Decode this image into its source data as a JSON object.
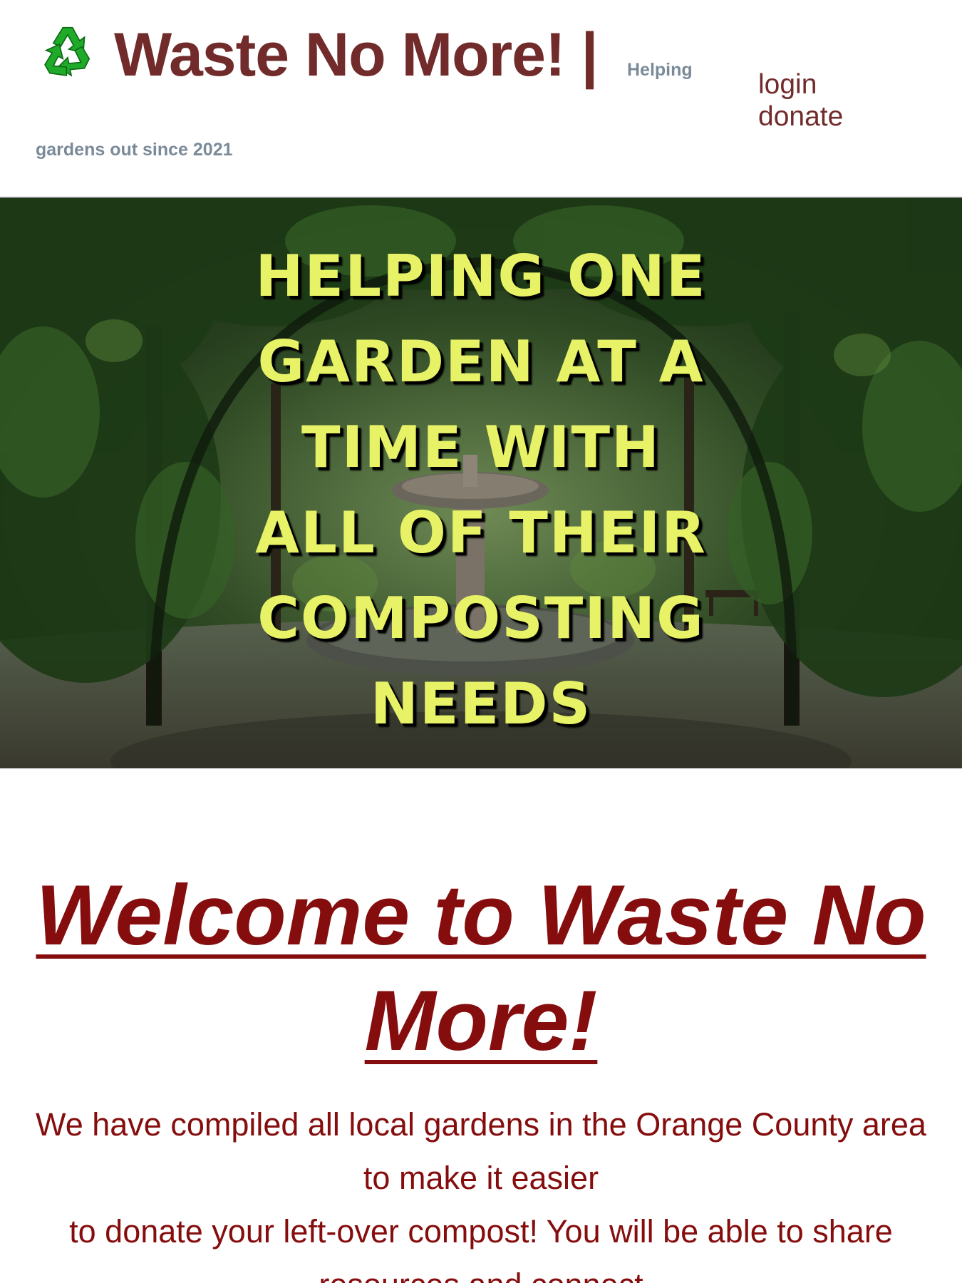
{
  "header": {
    "logo_icon": "recycle-icon",
    "title": "Waste No More! |",
    "tagline_part1": "Helping",
    "tagline_part2": "gardens out since 2021",
    "nav": {
      "login": "login",
      "donate": "donate"
    },
    "colors": {
      "title": "#722b2b",
      "tagline": "#7b8a99",
      "nav": "#722b2b"
    }
  },
  "hero": {
    "lines": [
      "HELPING ONE",
      "GARDEN AT A",
      "TIME WITH",
      "ALL OF THEIR",
      "COMPOSTING",
      "NEEDS"
    ],
    "text_color": "#e8f266",
    "background": "garden-arbor-with-fountain-photo"
  },
  "welcome": {
    "title": "Welcome to Waste No More!",
    "body_lines": [
      "We have compiled all local gardens in the Orange County area",
      "to make it easier",
      "to donate your left-over compost! You will be able to share",
      "resources and connect"
    ],
    "color": "#850d0d"
  }
}
